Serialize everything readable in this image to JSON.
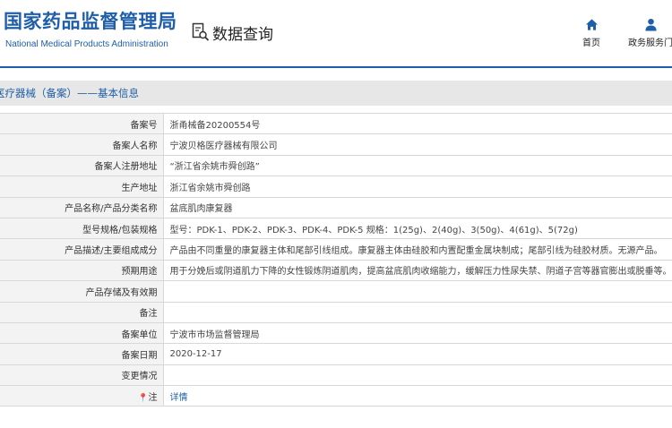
{
  "header": {
    "logo_cn": "国家药品监督管理局",
    "logo_en": "National Medical Products Administration",
    "search_label": "数据查询",
    "nav": [
      {
        "label": "首页",
        "icon": "home-icon"
      },
      {
        "label": "政务服务门",
        "icon": "user-icon"
      }
    ]
  },
  "section": {
    "title": "医疗器械（备案）——基本信息"
  },
  "colors": {
    "brand": "#1f5ea8",
    "label_bg": "#f3f3f3",
    "section_bg": "#e7e7e7",
    "border": "#d8d8d8"
  },
  "record": {
    "rows": [
      {
        "label": "备案号",
        "value": "浙甬械备20200554号"
      },
      {
        "label": "备案人名称",
        "value": "宁波贝格医疗器械有限公司"
      },
      {
        "label": "备案人注册地址",
        "value": "“浙江省余姚市舜创路”"
      },
      {
        "label": "生产地址",
        "value": "浙江省余姚市舜创路"
      },
      {
        "label": "产品名称/产品分类名称",
        "value": "盆底肌肉康复器"
      },
      {
        "label": "型号规格/包装规格",
        "value": "型号：PDK-1、PDK-2、PDK-3、PDK-4、PDK-5 规格：1(25g)、2(40g)、3(50g)、4(61g)、5(72g)"
      },
      {
        "label": "产品描述/主要组成成分",
        "value": "产品由不同重量的康复器主体和尾部引线组成。康复器主体由硅胶和内置配重金属块制成；尾部引线为硅胶材质。无源产品。"
      },
      {
        "label": "预期用途",
        "value": "用于分娩后或阴道肌力下降的女性锻炼阴道肌肉，提高盆底肌肉收缩能力，缓解压力性尿失禁、阴道子宫等器官膨出或脱垂等。"
      },
      {
        "label": "产品存储及有效期",
        "value": ""
      },
      {
        "label": "备注",
        "value": ""
      },
      {
        "label": "备案单位",
        "value": "宁波市市场监督管理局"
      },
      {
        "label": "备案日期",
        "value": "2020-12-17"
      },
      {
        "label": "变更情况",
        "value": ""
      }
    ],
    "note_row": {
      "label": "注",
      "link": "详情"
    }
  }
}
